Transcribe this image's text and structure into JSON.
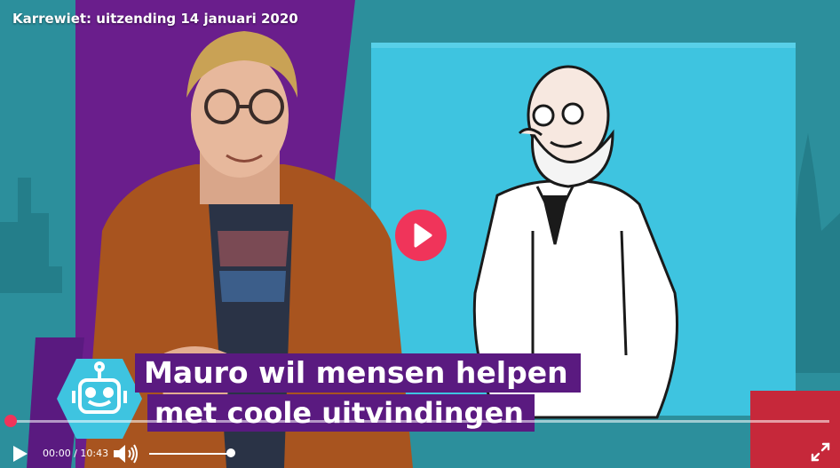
{
  "video": {
    "title": "Karrewiet: uitzending 14 januari 2020",
    "caption_line1": "Mauro wil mensen helpen",
    "caption_line2": "met coole uitvindingen"
  },
  "controls": {
    "time_display": "00:00 / 10:43",
    "progress": 0,
    "volume": 1
  },
  "colors": {
    "accent": "#f0345a",
    "caption_bg": "#5a1a80",
    "purple_panel": "#6a1e8c",
    "screen_blue": "#3ec4e0"
  },
  "icons": [
    "play-icon",
    "volume-icon",
    "fullscreen-icon",
    "robot-icon"
  ]
}
